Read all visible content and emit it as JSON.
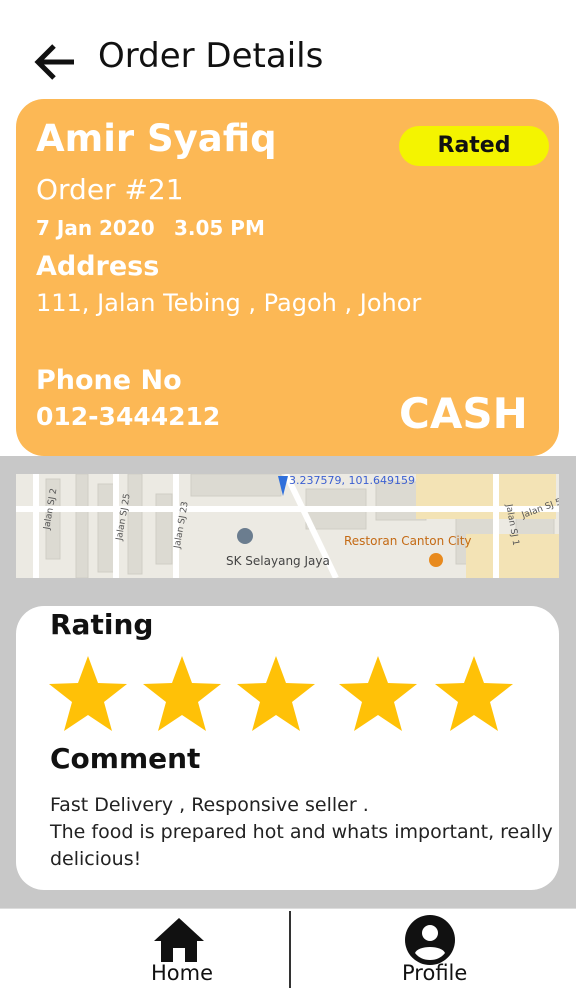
{
  "header": {
    "title": "Order Details",
    "back_icon": "arrow-left-icon"
  },
  "order": {
    "customer_name": "Amir Syafiq",
    "status_badge": "Rated",
    "order_number": "Order #21",
    "date": "7 Jan 2020",
    "time": "3.05 PM",
    "address_label": "Address",
    "address": "111, Jalan Tebing , Pagoh , Johor",
    "phone_label": "Phone No",
    "phone": "012-3444212",
    "payment_method": "CASH",
    "card_color": "#fcb855",
    "badge_color": "#f4f400"
  },
  "map": {
    "coordinates": "3.237579, 101.649159",
    "place_restaurant": "Restoran Canton City",
    "place_school": "SK Selayang Jaya",
    "roads": [
      "Jalan SJ 2",
      "Jalan SJ 25",
      "Jalan SJ 23",
      "Jalan SJ 1",
      "Jalan SJ 5"
    ]
  },
  "rating": {
    "title": "Rating",
    "stars": 5,
    "max_stars": 5,
    "star_color": "#ffc107",
    "comment_title": "Comment",
    "comment_lines": [
      "Fast Delivery , Responsive seller .",
      "The food is prepared hot and whats important, really",
      "delicious!"
    ]
  },
  "navbar": {
    "items": [
      {
        "label": "Home",
        "icon": "home-icon"
      },
      {
        "label": "Profile",
        "icon": "account-circle-icon"
      }
    ]
  }
}
